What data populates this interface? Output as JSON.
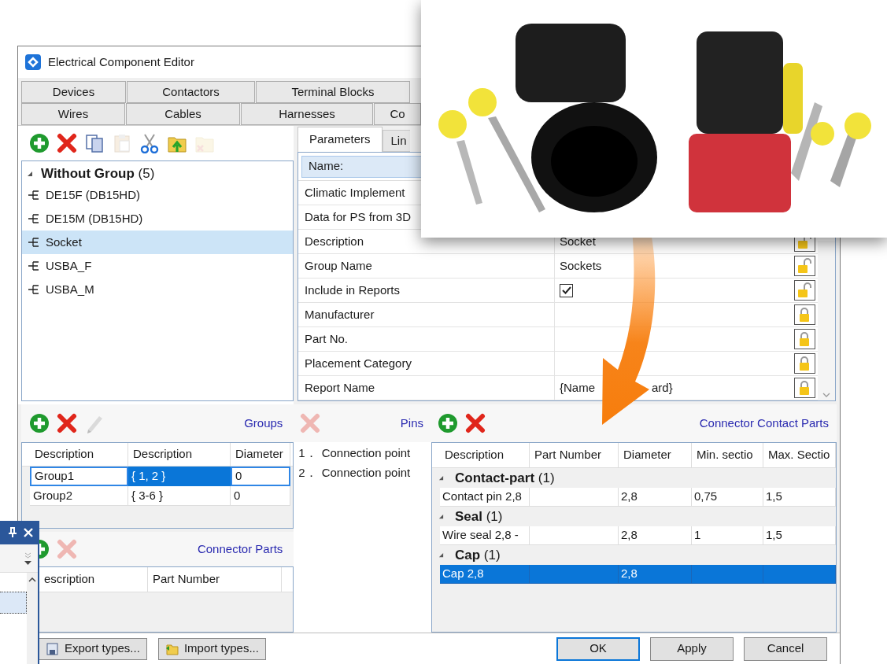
{
  "window": {
    "title": "Electrical Component Editor"
  },
  "tabs_row_1": [
    "Devices",
    "Contactors",
    "Terminal Blocks"
  ],
  "tabs_row_2": [
    "Wires",
    "Cables",
    "Harnesses",
    "Co"
  ],
  "tree_toolbar": [
    {
      "kind": "add",
      "disabled": false
    },
    {
      "kind": "delete",
      "disabled": false
    },
    {
      "kind": "copy",
      "disabled": false
    },
    {
      "kind": "paste",
      "disabled": true
    },
    {
      "kind": "cut",
      "disabled": false
    },
    {
      "kind": "folder_up",
      "disabled": false
    },
    {
      "kind": "folder_delete",
      "disabled": true
    }
  ],
  "tree": {
    "label": "Without Group",
    "count": "(5)",
    "expanded": true,
    "children": [
      {
        "label": "DE15F (DB15HD)",
        "selected": false
      },
      {
        "label": "DE15M (DB15HD)",
        "selected": false
      },
      {
        "label": "Socket",
        "selected": true
      },
      {
        "label": "USBA_F",
        "selected": false
      },
      {
        "label": "USBA_M",
        "selected": false
      }
    ]
  },
  "param_tabs": [
    {
      "label": "Parameters",
      "selected": true
    },
    {
      "label": "Lin",
      "selected": false
    }
  ],
  "parameters": [
    {
      "kind": "header",
      "name": "Name:"
    },
    {
      "kind": "covered",
      "name": "Climatic Implement"
    },
    {
      "kind": "covered",
      "name": "Data for PS from 3D"
    },
    {
      "kind": "text",
      "name": "Description",
      "value": "Socket",
      "locked": false
    },
    {
      "kind": "text",
      "name": "Group Name",
      "value": "Sockets",
      "locked": false
    },
    {
      "kind": "check",
      "name": "Include in Reports",
      "checked": true,
      "locked": false
    },
    {
      "kind": "text",
      "name": "Manufacturer",
      "locked": true
    },
    {
      "kind": "text",
      "name": "Part No.",
      "locked": true
    },
    {
      "kind": "text",
      "name": "Placement Category",
      "locked": true
    },
    {
      "kind": "split",
      "name": "Report Name",
      "value": "{Name",
      "value_tail": "ard}",
      "locked": true
    }
  ],
  "groups": {
    "title": "Groups",
    "toolbar": [
      {
        "kind": "add",
        "disabled": false
      },
      {
        "kind": "delete",
        "disabled": false
      },
      {
        "kind": "edit",
        "disabled": true
      }
    ],
    "columns": [
      "Description",
      "Description",
      "Diameter"
    ],
    "rows": [
      {
        "selected": true,
        "cells": [
          {
            "text": "Group1",
            "selected": false
          },
          {
            "text": "{ 1, 2 }",
            "selected": true
          },
          {
            "text": "0",
            "selected": false
          }
        ]
      },
      {
        "selected": false,
        "cells": [
          {
            "text": "Group2",
            "selected": false
          },
          {
            "text": "{ 3-6 }",
            "selected": false
          },
          {
            "text": "0",
            "selected": false
          }
        ]
      }
    ]
  },
  "pins": {
    "title": "Pins",
    "toolbar": [
      {
        "kind": "delete",
        "disabled": true
      }
    ],
    "items": [
      {
        "number": "1．",
        "label": "Connection point"
      },
      {
        "number": "2．",
        "label": "Connection point"
      }
    ]
  },
  "connector_parts": {
    "title": "Connector Parts",
    "toolbar": [
      {
        "kind": "add",
        "disabled": false
      },
      {
        "kind": "delete",
        "disabled": true
      }
    ],
    "columns": [
      "escription",
      "Part Number"
    ]
  },
  "contact_parts": {
    "title": "Connector Contact Parts",
    "toolbar": [
      {
        "kind": "add",
        "disabled": false
      },
      {
        "kind": "delete",
        "disabled": false
      }
    ],
    "columns": [
      "Description",
      "Part Number",
      "Diameter",
      "Min. sectio",
      "Max. Sectio"
    ],
    "groups": [
      {
        "label": "Contact-part",
        "count": "(1)",
        "expanded": true,
        "rows": [
          {
            "selected": false,
            "cells": [
              "Contact pin 2,8",
              "",
              "2,8",
              "0,75",
              "1,5"
            ]
          }
        ]
      },
      {
        "label": "Seal",
        "count": "(1)",
        "expanded": true,
        "rows": [
          {
            "selected": false,
            "cells": [
              "Wire seal 2,8 -",
              "",
              "2,8",
              "1",
              "1,5"
            ]
          }
        ]
      },
      {
        "label": "Cap",
        "count": "(1)",
        "expanded": true,
        "rows": [
          {
            "selected": true,
            "cells": [
              "Cap 2,8",
              "",
              "2,8",
              "",
              ""
            ]
          }
        ]
      }
    ]
  },
  "type_buttons": [
    {
      "kind": "export",
      "label": "Export types..."
    },
    {
      "kind": "import",
      "label": "Import types..."
    }
  ],
  "dialog_buttons": [
    {
      "label": "OK",
      "default": true
    },
    {
      "label": "Apply",
      "default": false
    },
    {
      "label": "Cancel",
      "default": false
    }
  ]
}
